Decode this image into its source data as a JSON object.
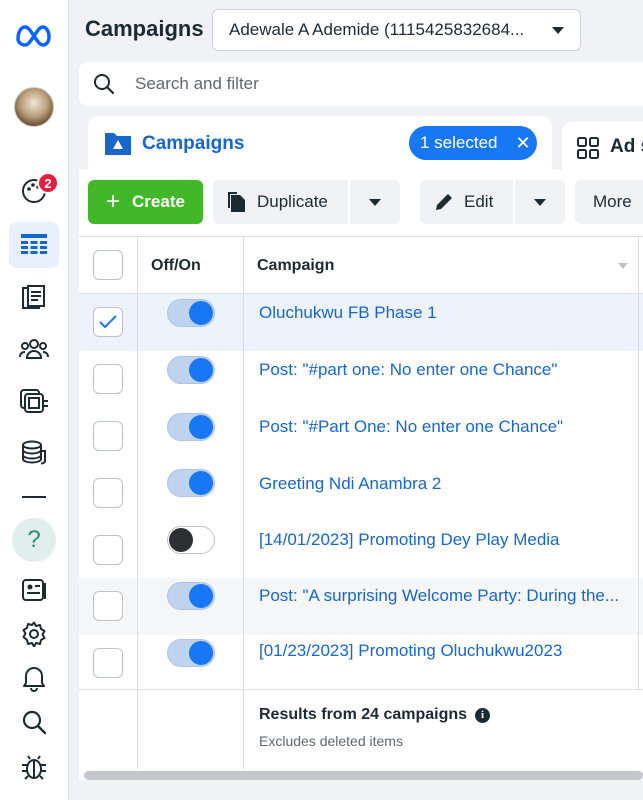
{
  "header": {
    "title": "Campaigns",
    "account_selector": "Adewale A Ademide (1115425832684..."
  },
  "search": {
    "placeholder": "Search and filter"
  },
  "rail": {
    "notification_count": "2",
    "help_glyph": "?",
    "icons": [
      "meta-logo",
      "profile-avatar",
      "emoji-notifications",
      "campaigns-table",
      "pages",
      "audiences",
      "catalog",
      "billing",
      "help",
      "account-settings",
      "settings-gear",
      "bell",
      "search",
      "bug-report"
    ]
  },
  "tabs": {
    "active_label": "Campaigns",
    "selected_text": "1 selected",
    "close_glyph": "✕",
    "second_label": "Ad s"
  },
  "toolbar": {
    "create_plus": "+",
    "create_label": "Create",
    "duplicate_label": "Duplicate",
    "edit_label": "Edit",
    "more_label": "More"
  },
  "table": {
    "headers": {
      "offon": "Off/On",
      "campaign": "Campaign"
    },
    "rows": [
      {
        "name": "Oluchukwu FB Phase 1",
        "on": true,
        "checked": true
      },
      {
        "name": "Post: \"#part one: No enter one Chance\"",
        "on": true,
        "checked": false
      },
      {
        "name": "Post: \"#Part One: No enter one Chance\"",
        "on": true,
        "checked": false
      },
      {
        "name": "Greeting Ndi Anambra 2",
        "on": true,
        "checked": false
      },
      {
        "name": "[14/01/2023] Promoting Dey Play Media",
        "on": false,
        "checked": false
      },
      {
        "name": "Post: \"A surprising Welcome Party: During the...",
        "on": true,
        "checked": false
      },
      {
        "name": "[01/23/2023] Promoting Oluchukwu2023",
        "on": true,
        "checked": false
      }
    ],
    "results_text": "Results from 24 campaigns",
    "info_glyph": "i",
    "excludes_text": "Excludes deleted items"
  },
  "colors": {
    "accent": "#1877f2",
    "link": "#1866c9",
    "create_green": "#42b72a",
    "badge_red": "#e41e3f"
  }
}
